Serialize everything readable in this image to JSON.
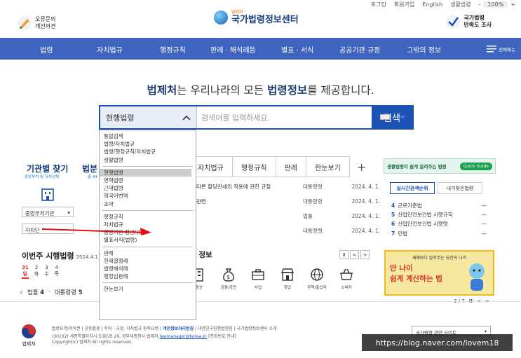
{
  "util": {
    "login": "로그인",
    "join": "회원가입",
    "english": "English",
    "guide": "생활법령",
    "minus": "-",
    "zoom": "100%",
    "plus": "+"
  },
  "header": {
    "feedback": [
      "오류문의",
      "개선의견"
    ],
    "logo_small": "법제처",
    "logo_title": "국가법령정보센터",
    "survey": [
      "국가법령",
      "만족도 조사"
    ]
  },
  "nav": {
    "items": [
      "법령",
      "자치법규",
      "행정규칙",
      "판례 · 해석례등",
      "별표 · 서식",
      "공공기관 규정",
      "그밖의 정보"
    ],
    "allmenu": "전체메뉴"
  },
  "headline": {
    "a": "법제처",
    "b": "는 우리나라의 모든 ",
    "c": "법령정보",
    "d": "를 제공합니다."
  },
  "search": {
    "selected": "현행법령",
    "placeholder": "검색어를 입력하세요.",
    "button": "검색"
  },
  "dropdown": {
    "g1": [
      "통합검색",
      "법령/자치법규",
      "법령/행정규칙/자치법규",
      "생활법령"
    ],
    "g2": [
      "현행법령",
      "연혁법령",
      "근대법령",
      "외국어번역",
      "조약"
    ],
    "g3": [
      "행정규칙",
      "자치법규",
      "공공기관 정관/규정",
      "별표서식(법령)"
    ],
    "g4": [
      "판례",
      "헌재결정례",
      "법령해석례",
      "행정심판례"
    ],
    "g5": [
      "한눈보기"
    ]
  },
  "left": {
    "t1": "기관별 찾기",
    "t1s": "중앙부처 및 자치단체",
    "t2": "법분",
    "t2s": "총 44",
    "select1": "중앙부처기관",
    "select2": "자치단"
  },
  "weekly": {
    "title": "이번주 시행법령",
    "date": "2024.4.1",
    "dates": [
      [
        "31",
        "일"
      ],
      [
        "2",
        "화"
      ],
      [
        "3",
        "수"
      ],
      [
        "4",
        "목"
      ]
    ],
    "nav_label": "법률",
    "nav_count": "4",
    "nav_sep": "·",
    "nav_label2": "대통령령",
    "nav_count2": "5"
  },
  "tabs": {
    "items": [
      "자치법규",
      "행정규칙",
      "판례",
      "한눈보기"
    ],
    "plus": "+"
  },
  "rows": [
    {
      "a": "따른 할당관세의 적용에 관한 규정",
      "b": "대통령령",
      "c": "2024. 4. 1."
    },
    {
      "a": "관련",
      "b": "대통령령",
      "c": "2024. 4. 1."
    },
    {
      "a": "",
      "b": "법률",
      "c": "2024. 4. 1."
    },
    {
      "a": "",
      "b": "대통령령",
      "c": "2024. 4. 1."
    }
  ],
  "info": {
    "title": "령 정보",
    "pause": "II",
    "prev": "<",
    "next": ">"
  },
  "cats": [
    {
      "name": "",
      "icon": "building"
    },
    {
      "name": "금융/공전",
      "icon": "money-bag"
    },
    {
      "name": "사업",
      "icon": "briefcase"
    },
    {
      "name": "창업",
      "icon": "store"
    },
    {
      "name": "무역/출입국",
      "icon": "globe"
    },
    {
      "name": "소비자",
      "icon": "basket"
    }
  ],
  "cat_partial": [
    "동산",
    "대"
  ],
  "right": {
    "banner": "생활법령이 쉽게 알려주는 법령",
    "quick": "Quick Guide",
    "tab_on": "실시간검색순위",
    "tab_off": "내가찾은법령",
    "rank": [
      {
        "n": "4",
        "t": "근로기준법",
        "s": "—"
      },
      {
        "n": "5",
        "t": "산업안전보건법 시행규칙",
        "s": "—"
      },
      {
        "n": "6",
        "t": "산업안전보건법 시행령",
        "s": "—"
      },
      {
        "n": "7",
        "t": "민법",
        "s": "—"
      }
    ],
    "ad_l1": "새해마다 알려주는 당신의 나이",
    "ad_l2": "만 나이",
    "ad_l3": "쉽게 계산하는 법",
    "ad_page": "3 / 7",
    "ad_pause": "II",
    "ad_prev": "<",
    "ad_next": ">"
  },
  "footer": {
    "logo": "법제처",
    "links_pre": "법령요약/저작권  |  공동활용  |  학칙 · 규정, 자치법규 등록요령  |  ",
    "privacy": "개인정보처리방침",
    "links_post": "  |  대한민국헌행법령집  |  국가법령정보센터 소개",
    "addr1_pre": "(30102) 세종특별자치시 도움5로 20, 정부세종청사 법제처 ",
    "email": "lawmanager@korea.kr",
    "addr1_post": " [전화번호 안내]",
    "addr2": "Copyright(c) 법제처 All rights reserved.",
    "site_select": "국가법령 관련 사이트"
  },
  "watermark": "https://blog.naver.com/lovem18",
  "colors": {
    "nav": "#3e64c0",
    "search_border": "#1d52b5",
    "arrow": "#e01010"
  }
}
